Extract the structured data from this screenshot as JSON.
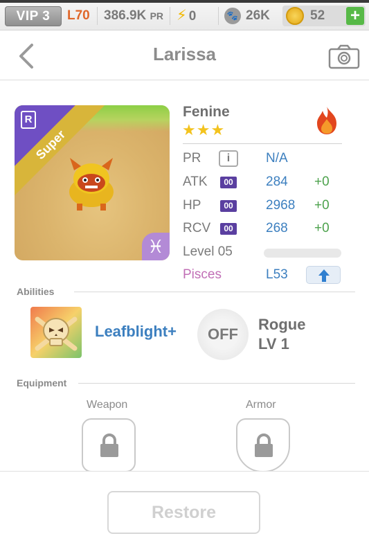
{
  "topbar": {
    "vip": "VIP 3",
    "level": "L70",
    "pr_value": "386.9K",
    "pr_unit": "PR",
    "energy": "0",
    "food": "26K",
    "coins": "52",
    "plus": "+"
  },
  "header": {
    "title": "Larissa"
  },
  "monster": {
    "rank": "R",
    "ribbon": "Super",
    "zodiac_symbol": "♓",
    "name": "Fenine",
    "stars": "★★★",
    "element": "fire",
    "stats": {
      "pr": {
        "label": "PR",
        "info": "i",
        "value": "N/A"
      },
      "atk": {
        "label": "ATK",
        "badge": "00",
        "value": "284",
        "bonus": "+0"
      },
      "hp": {
        "label": "HP",
        "badge": "00",
        "value": "2968",
        "bonus": "+0"
      },
      "rcv": {
        "label": "RCV",
        "badge": "00",
        "value": "268",
        "bonus": "+0"
      },
      "level": {
        "label": "Level 05",
        "progress": 0.0
      },
      "zodiac": {
        "label": "Pisces",
        "value": "L53"
      }
    }
  },
  "abilities": {
    "header": "Abilities",
    "active": {
      "name": "Leafblight+"
    },
    "passive": {
      "state": "OFF",
      "name": "Rogue",
      "level": "LV 1"
    }
  },
  "equipment": {
    "header": "Equipment",
    "weapon_label": "Weapon",
    "armor_label": "Armor"
  },
  "footer": {
    "restore_label": "Restore"
  },
  "colors": {
    "accent_blue": "#3c7fbf",
    "bonus_green": "#4da24d",
    "pisces_pink": "#c16fb6",
    "level_orange": "#e0672a",
    "rank_purple": "#6f4fc3"
  }
}
